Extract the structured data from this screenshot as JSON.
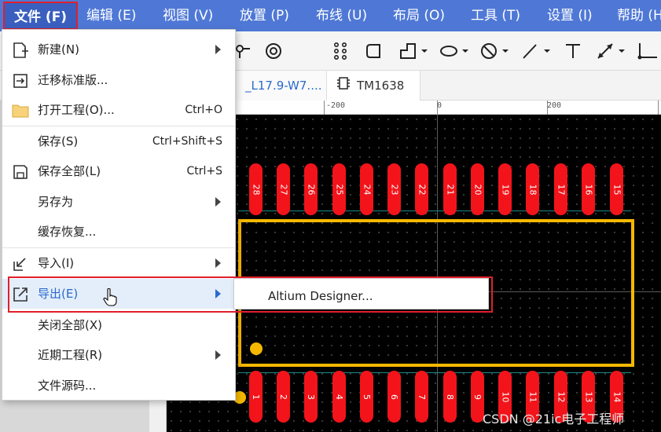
{
  "menubar": {
    "items": [
      "文件 (F)",
      "编辑 (E)",
      "视图 (V)",
      "放置 (P)",
      "布线 (U)",
      "布局 (O)",
      "工具 (T)",
      "设置 (I)",
      "帮助 (H"
    ]
  },
  "tabs": [
    {
      "label": "_L17.9-W7...."
    },
    {
      "label": "TM1638"
    }
  ],
  "ruler": {
    "labels": [
      "-200",
      "0",
      "200"
    ]
  },
  "file_menu": {
    "items": [
      {
        "label": "新建(N)",
        "shortcut": "",
        "submenu": true
      },
      {
        "label": "迁移标准版...",
        "shortcut": "",
        "submenu": false
      },
      {
        "label": "打开工程(O)...",
        "shortcut": "Ctrl+O",
        "submenu": false
      },
      {
        "label": "保存(S)",
        "shortcut": "Ctrl+Shift+S",
        "submenu": false
      },
      {
        "label": "保存全部(L)",
        "shortcut": "Ctrl+S",
        "submenu": false
      },
      {
        "label": "另存为",
        "shortcut": "",
        "submenu": true
      },
      {
        "label": "缓存恢复...",
        "shortcut": "",
        "submenu": false
      },
      {
        "label": "导入(I)",
        "shortcut": "",
        "submenu": true
      },
      {
        "label": "导出(E)",
        "shortcut": "",
        "submenu": true
      },
      {
        "label": "关闭全部(X)",
        "shortcut": "",
        "submenu": false
      },
      {
        "label": "近期工程(R)",
        "shortcut": "",
        "submenu": true
      },
      {
        "label": "文件源码...",
        "shortcut": "",
        "submenu": false
      }
    ]
  },
  "export_submenu": {
    "items": [
      "Altium Designer..."
    ]
  },
  "pcb": {
    "top_pins": [
      "28",
      "27",
      "26",
      "25",
      "24",
      "23",
      "22",
      "21",
      "20",
      "19",
      "18",
      "17",
      "16",
      "15"
    ],
    "bottom_pins": [
      "1",
      "2",
      "3",
      "4",
      "5",
      "6",
      "7",
      "8",
      "9",
      "10",
      "11",
      "12",
      "13",
      "14"
    ]
  },
  "watermark": "CSDN @21ic电子工程师",
  "colors": {
    "menubar": "#4f78d6",
    "pad": "#f2141a",
    "outline": "#f5b800",
    "highlight_box": "#e0202c"
  }
}
